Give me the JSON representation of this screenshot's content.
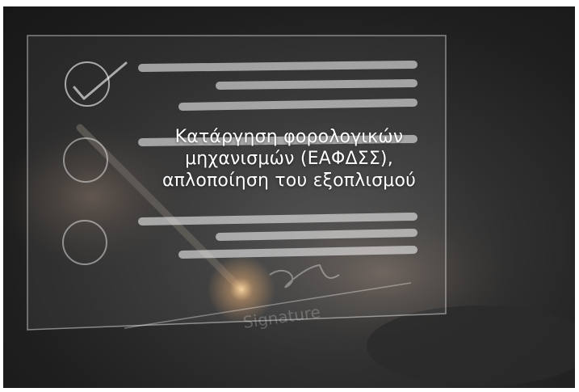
{
  "hero": {
    "title_lines": [
      "Κατάργηση φορολογικών",
      "μηχανισμών (ΕΑΦΔΣΣ),",
      "απλοποίηση του εξοπλισμού"
    ],
    "signature_label": "Signature"
  },
  "colors": {
    "background": "#1f1f1f",
    "overlay_lines": "#ffffff",
    "title_text": "#ffffff"
  },
  "icons": {
    "check": "checkmark-circle",
    "empty_circles": 2
  }
}
